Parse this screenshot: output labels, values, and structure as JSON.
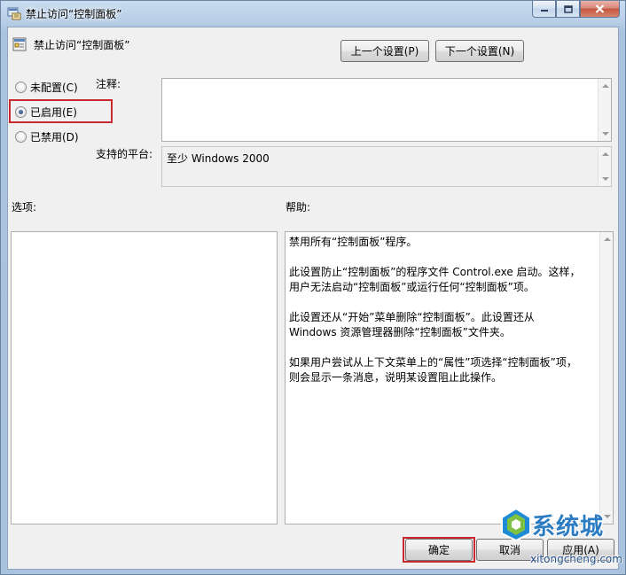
{
  "window": {
    "title": "禁止访问“控制面板”"
  },
  "header": {
    "setting_name": "禁止访问“控制面板”",
    "prev_button": "上一个设置(P)",
    "next_button": "下一个设置(N)"
  },
  "state": {
    "options": [
      {
        "label": "未配置(C)",
        "checked": false
      },
      {
        "label": "已启用(E)",
        "checked": true
      },
      {
        "label": "已禁用(D)",
        "checked": false
      }
    ]
  },
  "comment": {
    "label": "注释:",
    "value": ""
  },
  "platform": {
    "label": "支持的平台:",
    "value": "至少 Windows 2000"
  },
  "options_section": {
    "label": "选项:"
  },
  "help_section": {
    "label": "帮助:",
    "lines": [
      "禁用所有“控制面板”程序。",
      "",
      "此设置防止“控制面板”的程序文件 Control.exe 启动。这样，",
      "用户无法启动“控制面板”或运行任何“控制面板”项。",
      "",
      "此设置还从“开始”菜单删除“控制面板”。此设置还从",
      "Windows 资源管理器删除“控制面板”文件夹。",
      "",
      "如果用户尝试从上下文菜单上的“属性”项选择“控制面板”项，",
      "则会显示一条消息，说明某设置阻止此操作。"
    ]
  },
  "footer": {
    "ok_button": "确定",
    "cancel_button": "取消",
    "apply_button": "应用(A)"
  },
  "watermark": {
    "text": "系统城",
    "url": "xitongcheng.com"
  },
  "colors": {
    "highlight_border": "#c8282e",
    "title_gradient_top": "#c9dcf0",
    "close_button": "#c5553f"
  }
}
